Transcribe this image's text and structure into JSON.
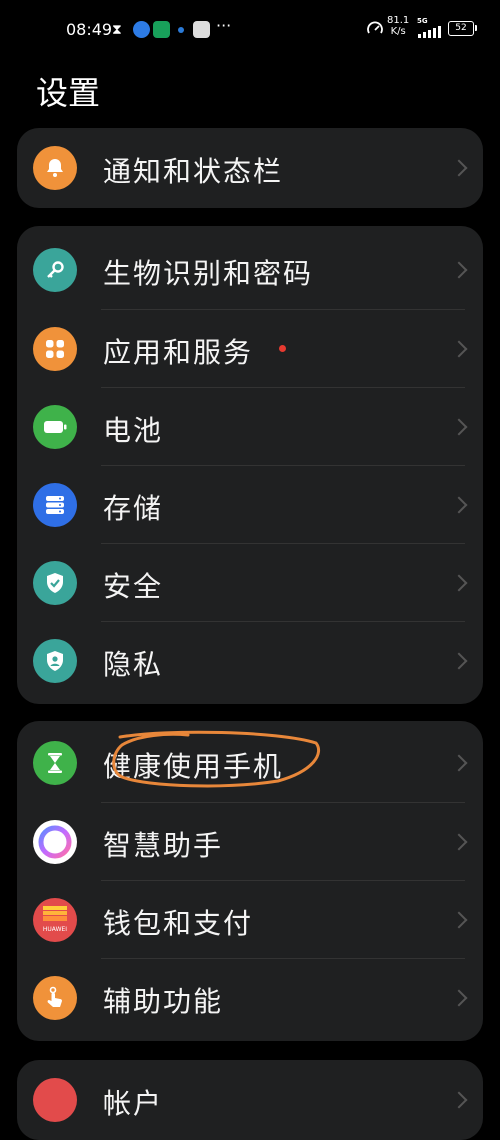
{
  "status_bar": {
    "time": "08:49",
    "net_speed_value": "81.1",
    "net_speed_unit": "K/s",
    "network_type": "5G",
    "battery_level": "52"
  },
  "page": {
    "title": "设置"
  },
  "colors": {
    "background": "#000000",
    "card": "#1f2021",
    "annotation": "#e8873a"
  },
  "groups": [
    {
      "items": [
        {
          "label": "通知和状态栏",
          "icon": "bell-icon",
          "icon_color": "#f0923a"
        }
      ]
    },
    {
      "items": [
        {
          "label": "生物识别和密码",
          "icon": "key-icon",
          "icon_color": "#3aa59a"
        },
        {
          "label": "应用和服务",
          "icon": "apps-icon",
          "icon_color": "#f0923a",
          "badge": "red-dot"
        },
        {
          "label": "电池",
          "icon": "battery-icon",
          "icon_color": "#3fb24a"
        },
        {
          "label": "存储",
          "icon": "storage-icon",
          "icon_color": "#2f6fe6"
        },
        {
          "label": "安全",
          "icon": "shield-icon",
          "icon_color": "#3aa59a"
        },
        {
          "label": "隐私",
          "icon": "privacy-icon",
          "icon_color": "#3aa59a"
        }
      ]
    },
    {
      "items": [
        {
          "label": "健康使用手机",
          "icon": "hourglass-icon",
          "icon_color": "#3fb24a"
        },
        {
          "label": "智慧助手",
          "icon": "assistant-icon",
          "icon_color": "#ffffff"
        },
        {
          "label": "钱包和支付",
          "icon": "wallet-icon",
          "icon_color": "#e24b4b",
          "icon_text": "HUAWEI"
        },
        {
          "label": "辅助功能",
          "icon": "accessibility-icon",
          "icon_color": "#f0923a"
        }
      ]
    },
    {
      "items": [
        {
          "label": "帐户",
          "icon": "account-icon",
          "icon_color": "#e24b4b"
        }
      ]
    }
  ]
}
